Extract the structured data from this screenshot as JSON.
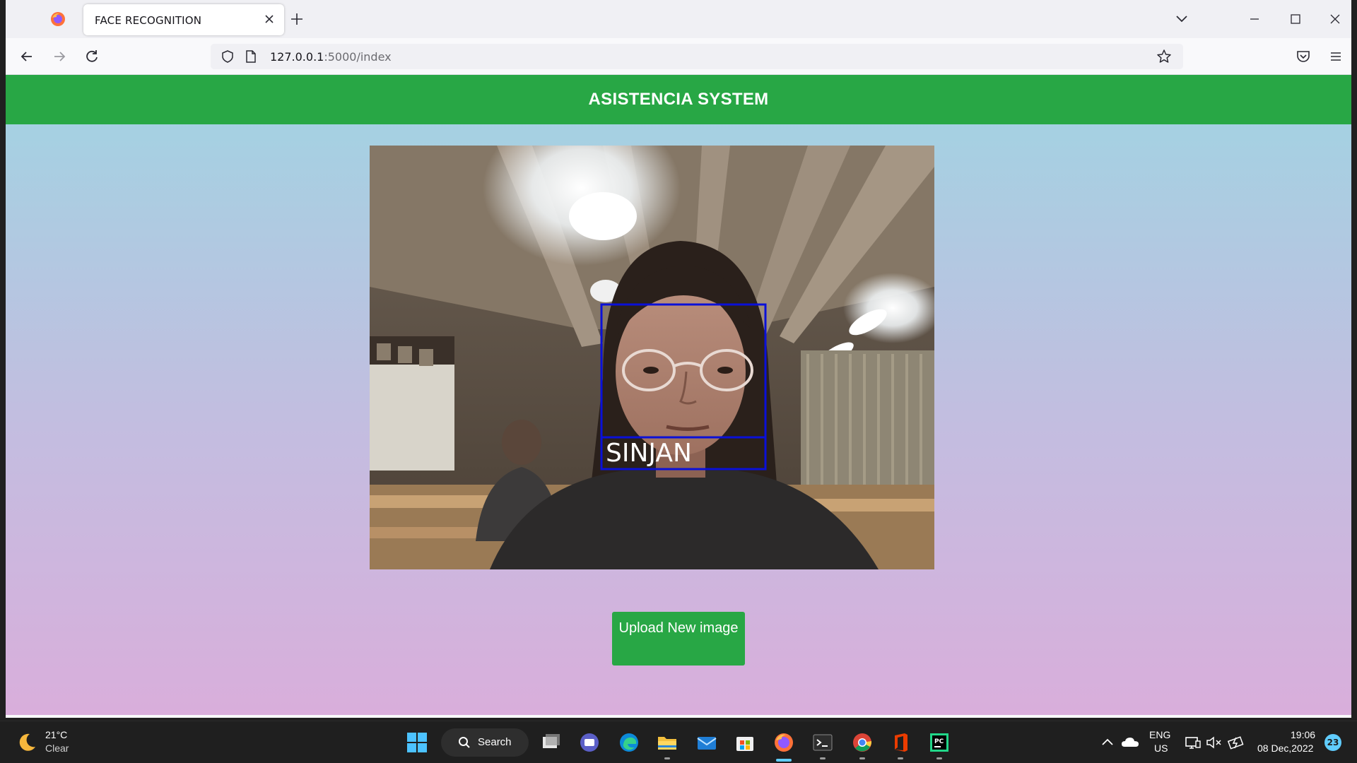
{
  "browser": {
    "tab_title": "FACE RECOGNITION",
    "url_host": "127.0.0.1",
    "url_rest": ":5000/index"
  },
  "page": {
    "site_title": "ASISTENCIA SYSTEM",
    "detection_label": "SINJAN",
    "upload_button": "Upload New image",
    "colors": {
      "header": "#28a745",
      "button": "#28a745",
      "box": "#0a10d8"
    }
  },
  "taskbar": {
    "weather_temp": "21°C",
    "weather_desc": "Clear",
    "search_label": "Search",
    "lang_top": "ENG",
    "lang_bottom": "US",
    "time": "19:06",
    "date": "08 Dec,2022",
    "notification_count": "23"
  }
}
